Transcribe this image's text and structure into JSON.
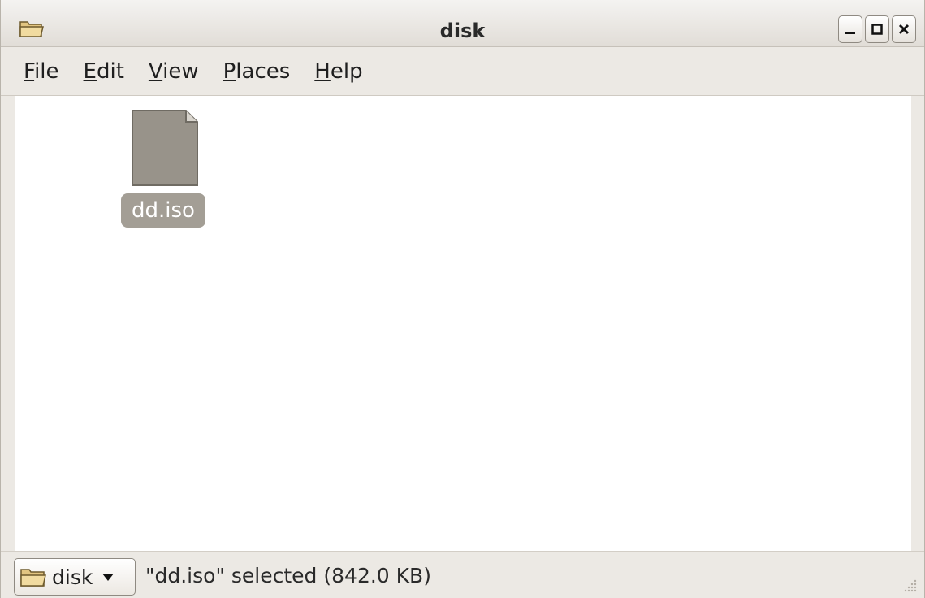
{
  "window": {
    "title": "disk",
    "controls": {
      "minimize": "minimize-icon",
      "maximize": "maximize-icon",
      "close": "close-icon"
    }
  },
  "menubar": {
    "items": [
      {
        "mnemonic": "F",
        "rest": "ile"
      },
      {
        "mnemonic": "E",
        "rest": "dit"
      },
      {
        "mnemonic": "V",
        "rest": "iew"
      },
      {
        "mnemonic": "P",
        "rest": "laces"
      },
      {
        "mnemonic": "H",
        "rest": "elp"
      }
    ]
  },
  "content": {
    "files": [
      {
        "name": "dd.iso",
        "icon": "file-icon",
        "selected": true
      }
    ]
  },
  "statusbar": {
    "location_label": "disk",
    "status_text": "\"dd.iso\" selected (842.0 KB)"
  },
  "colors": {
    "window_bg": "#ece9e4",
    "content_bg": "#ffffff",
    "selection_bg": "#a39e95",
    "file_icon_fill": "#98938a",
    "folder_fill": "#e8cf8a"
  }
}
